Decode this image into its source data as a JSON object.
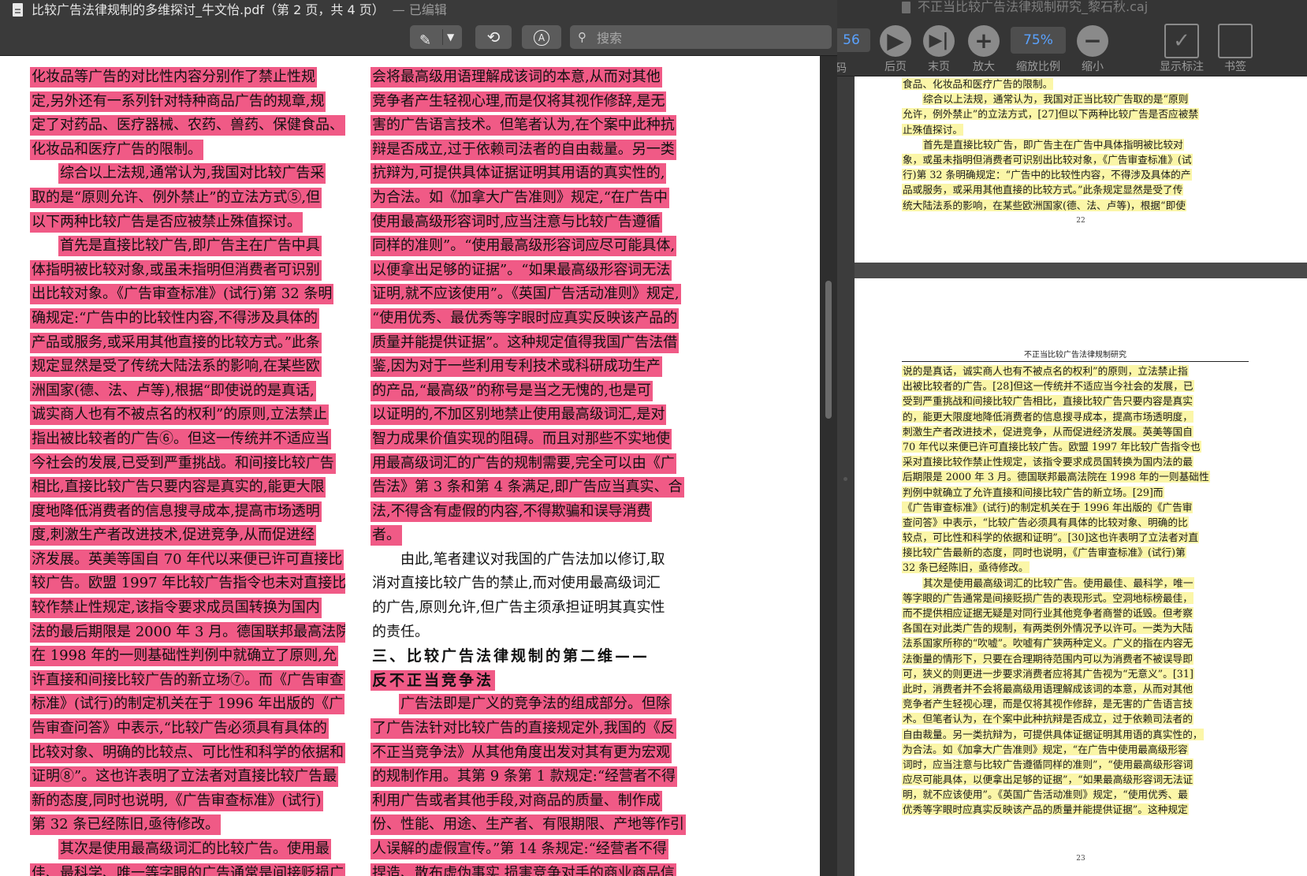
{
  "left_window": {
    "title": "比较广告法律规制的多维探讨_牛文怡.pdf（第 2 页，共 4 页）",
    "edited_label": "— 已编辑",
    "search_placeholder": "搜索",
    "toolbar_icons": {
      "markup": "pen-icon",
      "rotate": "rotate-icon",
      "annotate": "markup-circle-icon",
      "search": "search-icon"
    },
    "highlight_color": "#f05a86",
    "page": {
      "left_column": [
        {
          "t": "化妆品等广告的对比性内容分别作了禁止性规",
          "hl": true
        },
        {
          "t": "定,另外还有一系列针对特种商品广告的规章,规",
          "hl": true
        },
        {
          "t": "定了对药品、医疗器械、农药、兽药、保健食品、",
          "hl": true
        },
        {
          "t": "化妆品和医疗广告的限制。",
          "hl": true
        },
        {
          "t": "综合以上法规,通常认为,我国对比较广告采",
          "hl": true,
          "indent": true
        },
        {
          "t": "取的是“原则允许、例外禁止”的立法方式⑤,但",
          "hl": true
        },
        {
          "t": "以下两种比较广告是否应被禁止殊值探讨。",
          "hl": true
        },
        {
          "t": "首先是直接比较广告,即广告主在广告中具",
          "hl": true,
          "indent": true
        },
        {
          "t": "体指明被比较对象,或虽未指明但消费者可识别",
          "hl": true
        },
        {
          "t": "出比较对象。《广告审查标准》(试行)第 32 条明",
          "hl": true
        },
        {
          "t": "确规定:“广告中的比较性内容,不得涉及具体的",
          "hl": true
        },
        {
          "t": "产品或服务,或采用其他直接的比较方式。”此条",
          "hl": true
        },
        {
          "t": "规定显然是受了传统大陆法系的影响,在某些欧",
          "hl": true
        },
        {
          "t": "洲国家(德、法、卢等),根据“即使说的是真话,",
          "hl": true
        },
        {
          "t": "诚实商人也有不被点名的权利”的原则,立法禁止",
          "hl": true
        },
        {
          "t": "指出被比较者的广告⑥。但这一传统并不适应当",
          "hl": true
        },
        {
          "t": "今社会的发展,已受到严重挑战。和间接比较广告",
          "hl": true
        },
        {
          "t": "相比,直接比较广告只要内容是真实的,能更大限",
          "hl": true
        },
        {
          "t": "度地降低消费者的信息搜寻成本,提高市场透明",
          "hl": true
        },
        {
          "t": "度,刺激生产者改进技术,促进竞争,从而促进经",
          "hl": true
        },
        {
          "t": "济发展。英美等国自 70 年代以来便已许可直接比",
          "hl": true
        },
        {
          "t": "较广告。欧盟 1997 年比较广告指令也未对直接比",
          "hl": true
        },
        {
          "t": "较作禁止性规定,该指令要求成员国转换为国内",
          "hl": true
        },
        {
          "t": "法的最后期限是 2000 年 3 月。德国联邦最高法院",
          "hl": true
        },
        {
          "t": "在 1998 年的一则基础性判例中就确立了原则,允",
          "hl": true
        },
        {
          "t": "许直接和间接比较广告的新立场⑦。而《广告审查",
          "hl": true
        },
        {
          "t": "标准》(试行)的制定机关在于 1996 年出版的《广",
          "hl": true
        },
        {
          "t": "告审查问答》中表示,“比较广告必须具有具体的",
          "hl": true
        },
        {
          "t": "比较对象、明确的比较点、可比性和科学的依据和",
          "hl": true
        },
        {
          "t": "证明⑧”。这也许表明了立法者对直接比较广告最",
          "hl": true
        },
        {
          "t": "新的态度,同时也说明,《广告审查标准》(试行)",
          "hl": true
        },
        {
          "t": "第 32 条已经陈旧,亟待修改。",
          "hl": true
        },
        {
          "t": "其次是使用最高级词汇的比较广告。使用最",
          "hl": true,
          "indent": true
        },
        {
          "t": "佳、最科学、唯一等字眼的广告通常是间接贬损广",
          "hl": true
        }
      ],
      "right_column": [
        {
          "t": "会将最高级用语理解成该词的本意,从而对其他",
          "hl": true
        },
        {
          "t": "竞争者产生轻视心理,而是仅将其视作修辞,是无",
          "hl": true
        },
        {
          "t": "害的广告语言技术。但笔者认为,在个案中此种抗",
          "hl": true
        },
        {
          "t": "辩是否成立,过于依赖司法者的自由裁量。另一类",
          "hl": true
        },
        {
          "t": "抗辩为,可提供具体证据证明其用语的真实性的,",
          "hl": true
        },
        {
          "t": "为合法。如《加拿大广告准则》规定,“在广告中",
          "hl": true
        },
        {
          "t": "使用最高级形容词时,应当注意与比较广告遵循",
          "hl": true
        },
        {
          "t": "同样的准则”。“使用最高级形容词应尽可能具体,",
          "hl": true
        },
        {
          "t": "以便拿出足够的证据”。“如果最高级形容词无法",
          "hl": true
        },
        {
          "t": "证明,就不应该使用”。《英国广告活动准则》规定,",
          "hl": true
        },
        {
          "t": "“使用优秀、最优秀等字眼时应真实反映该产品的",
          "hl": true
        },
        {
          "t": "质量并能提供证据”。这种规定值得我国广告法借",
          "hl": true
        },
        {
          "t": "鉴,因为对于一些利用专利技术或科研成功生产",
          "hl": true
        },
        {
          "t": "的产品,“最高级”的称号是当之无愧的,也是可",
          "hl": true
        },
        {
          "t": "以证明的,不加区别地禁止使用最高级词汇,是对",
          "hl": true
        },
        {
          "t": "智力成果价值实现的阻碍。而且对那些不实地使",
          "hl": true
        },
        {
          "t": "用最高级词汇的广告的规制需要,完全可以由《广",
          "hl": true
        },
        {
          "t": "告法》第 3 条和第 4 条满足,即广告应当真实、合",
          "hl": true
        },
        {
          "t": "法,不得含有虚假的内容,不得欺骗和误导消费",
          "hl": true
        },
        {
          "t": "者。",
          "hl": true
        },
        {
          "t": "由此,笔者建议对我国的广告法加以修订,取",
          "hl": false,
          "indent": true
        },
        {
          "t": "消对直接比较广告的禁止,而对使用最高级词汇",
          "hl": false
        },
        {
          "t": "的广告,原则允许,但广告主须承担证明其真实性",
          "hl": false
        },
        {
          "t": "的责任。",
          "hl": false
        },
        {
          "t": "三、比较广告法律规制的第二维——",
          "hl": false,
          "heading": true
        },
        {
          "t": "反不正当竞争法",
          "hl": true,
          "heading": true
        },
        {
          "t": "广告法即是广义的竞争法的组成部分。但除",
          "hl": true,
          "indent": true
        },
        {
          "t": "了广告法针对比较广告的直接规定外,我国的《反",
          "hl": true
        },
        {
          "t": "不正当竞争法》从其他角度出发对其有更为宏观",
          "hl": true
        },
        {
          "t": "的规制作用。其第 9 条第 1 款规定:“经营者不得",
          "hl": true
        },
        {
          "t": "利用广告或者其他手段,对商品的质量、制作成",
          "hl": true
        },
        {
          "t": "份、性能、用途、生产者、有限期限、产地等作引",
          "hl": true
        },
        {
          "t": "人误解的虚假宣传。”第 14 条规定:“经营者不得",
          "hl": true
        },
        {
          "t": "捏造、散布虚伪事实,损害竞争对手的商业商品信",
          "hl": true
        }
      ]
    }
  },
  "right_window": {
    "title": "不正当比较广告法律规制研究_黎石秋.caj",
    "toolbar": {
      "page_value": "56",
      "page_label": "码",
      "next_label": "后页",
      "last_label": "末页",
      "zoom_in_label": "放大",
      "zoom_value": "75%",
      "zoom_ratio_label": "缩放比例",
      "zoom_out_label": "缩小",
      "show_marks_label": "显示标注",
      "bookmark_label": "书签"
    },
    "highlight_color": "#fbf6a8",
    "page1": {
      "lines": [
        {
          "t": "食品、化妆品和医疗广告的限制。"
        },
        {
          "t": "综合以上法规，通常认为，我国对正当比较广告取的是“原则",
          "indent": true
        },
        {
          "t": "允许，例外禁止”的立法方式，[27]但以下两种比较广告是否应被禁"
        },
        {
          "t": "止殊值探讨。"
        },
        {
          "t": "首先是直接比较广告，即广告主在广告中具体指明被比较对",
          "indent": true
        },
        {
          "t": "象，或虽未指明但消费者可识别出比较对象，《广告审查标准》(试"
        },
        {
          "t": "行)第 32 条明确规定：“广告中的比较性内容，不得涉及具体的产"
        },
        {
          "t": "品或服务，或采用其他直接的比较方式。”此条规定显然是受了传"
        },
        {
          "t": "统大陆法系的影响，在某些欧洲国家(德、法、卢等)，根据“即使"
        }
      ],
      "page_number": "22"
    },
    "page2": {
      "header": "不正当比较广告法律规制研究",
      "lines": [
        {
          "t": "说的是真话，诚实商人也有不被点名的权利”的原则，立法禁止指"
        },
        {
          "t": "出被比较者的广告。[28]但这一传统并不适应当今社会的发展，已"
        },
        {
          "t": "受到严重挑战和间接比较广告相比，直接比较广告只要内容是真实"
        },
        {
          "t": "的，能更大限度地降低消费者的信息搜寻成本，提高市场透明度，"
        },
        {
          "t": "刺激生产者改进技术，促进竞争，从而促进经济发展。英美等国自"
        },
        {
          "t": "70 年代以来便已许可直接比较广告。欧盟 1997 年比较广告指令也"
        },
        {
          "t": "采对直接比较作禁止性规定，该指令要求成员国转换为国内法的最"
        },
        {
          "t": "后期限是 2000 年 3 月。德国联邦最高法院在 1998 年的一则基础性"
        },
        {
          "t": "判例中就确立了允许直接和间接比较广告的新立场。[29]而"
        },
        {
          "t": "《广告审查标准》(试行)的制定机关在于 1996 年出版的《广告审"
        },
        {
          "t": "查问答》中表示，“比较广告必须具有具体的比较对象、明确的比"
        },
        {
          "t": "较点，可比性和科学的依据和证明”。[30]这也许表明了立法者对直"
        },
        {
          "t": "接比较广告最新的态度，同时也说明，《广告审查标准》(试行)第"
        },
        {
          "t": "32 条已经陈旧，亟待修改。"
        },
        {
          "t": "其次是使用最高级词汇的比较广告。使用最佳、最科学，唯一",
          "indent": true
        },
        {
          "t": "等字眼的广告通常是间接贬损广告的表现形式。空洞地标榜最佳，"
        },
        {
          "t": "而不提供相应证据无疑是对同行业其他竞争者商誉的诋毁。但考察"
        },
        {
          "t": "各国在对此类广告的规制，有两类例外情况予以许可。一类为大陆"
        },
        {
          "t": "法系国家所称的“吹嘘”。吹嘘有广狭两种定义。广义的指在内容无"
        },
        {
          "t": "法衡量的情形下，只要在合理期待范围内可以为消费者不被误导即"
        },
        {
          "t": "可，狭义的则更进一步要求消费者应将其广告视为“无意义”。[31]"
        },
        {
          "t": "此时，消费者并不会将最高级用语理解成该词的本意，从而对其他"
        },
        {
          "t": "竞争者产生轻视心理，而是仅将其视作修辞，是无害的广告语言技"
        },
        {
          "t": "术。但笔者认为，在个案中此种抗辩是否成立，过于依赖司法者的"
        },
        {
          "t": "自由裁量。另一类抗辩为，可提供具体证据证明其用语的真实性的，"
        },
        {
          "t": "为合法。如《加拿大广告准则》规定，“在广告中使用最高级形容"
        },
        {
          "t": "词时，应当注意与比较广告遵循同样的准则”，“使用最高级形容词"
        },
        {
          "t": "应尽可能具体，以便拿出足够的证据”，“如果最高级形容词无法证"
        },
        {
          "t": "明，就不应该使用”。《英国广告活动准则》规定，“使用优秀、最"
        },
        {
          "t": "优秀等字眼时应真实反映该产品的质量并能提供证据”。这种规定"
        }
      ],
      "page_number": "23"
    }
  }
}
